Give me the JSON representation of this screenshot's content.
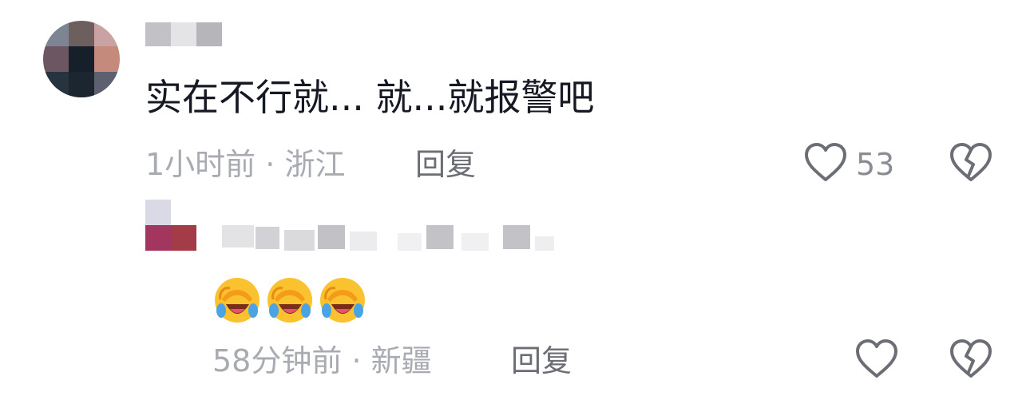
{
  "comment": {
    "text": "实在不行就... 就...就报警吧",
    "time": "1小时前",
    "location": "浙江",
    "reply_label": "回复",
    "like_count": "53"
  },
  "reply": {
    "emojis": [
      "rofl-emoji",
      "rofl-emoji",
      "rofl-emoji"
    ],
    "time": "58分钟前",
    "location": "新疆",
    "reply_label": "回复"
  },
  "colors": {
    "primary_text": "#161823",
    "meta_text": "#a9abb3",
    "reply_text": "#6c6e75",
    "icon": "#6c6e75"
  }
}
